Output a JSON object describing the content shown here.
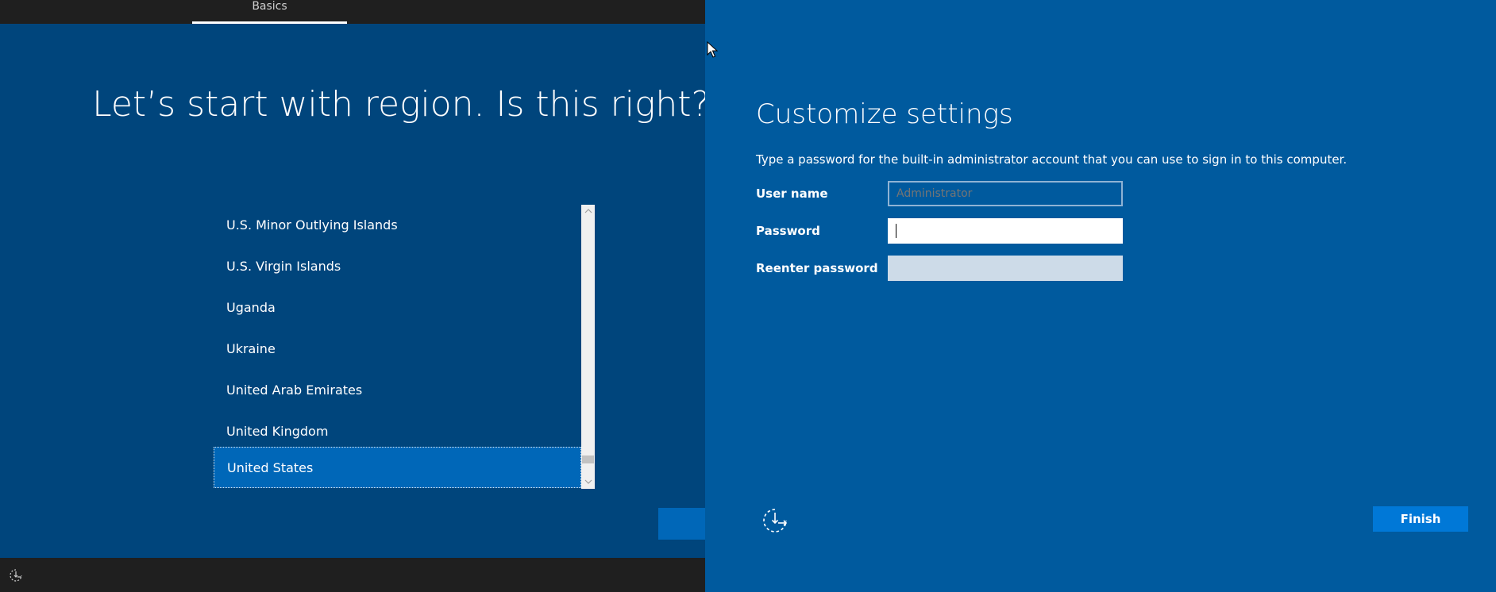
{
  "setup": {
    "tab_label": "Basics",
    "title": "Let’s start with region. Is this right?",
    "regions": [
      "U.S. Minor Outlying Islands",
      "U.S. Virgin Islands",
      "Uganda",
      "Ukraine",
      "United Arab Emirates",
      "United Kingdom",
      "United States"
    ],
    "selected_region": "United States"
  },
  "settings": {
    "title": "Customize settings",
    "description": "Type a password for the built-in administrator account that you can use to sign in to this computer.",
    "username_label": "User name",
    "username_placeholder": "Administrator",
    "password_label": "Password",
    "password_value": "",
    "reenter_label": "Reenter password",
    "reenter_value": "",
    "finish_label": "Finish"
  },
  "icons": {
    "accessibility": "ease-of-access-icon",
    "cursor": "mouse-pointer-icon",
    "scroll_up": "chevron-up-icon",
    "scroll_down": "chevron-down-icon"
  },
  "colors": {
    "left_background": "#00457c",
    "right_background": "#005a9e",
    "selection": "#0067b8",
    "finish_button": "#0078d7"
  }
}
